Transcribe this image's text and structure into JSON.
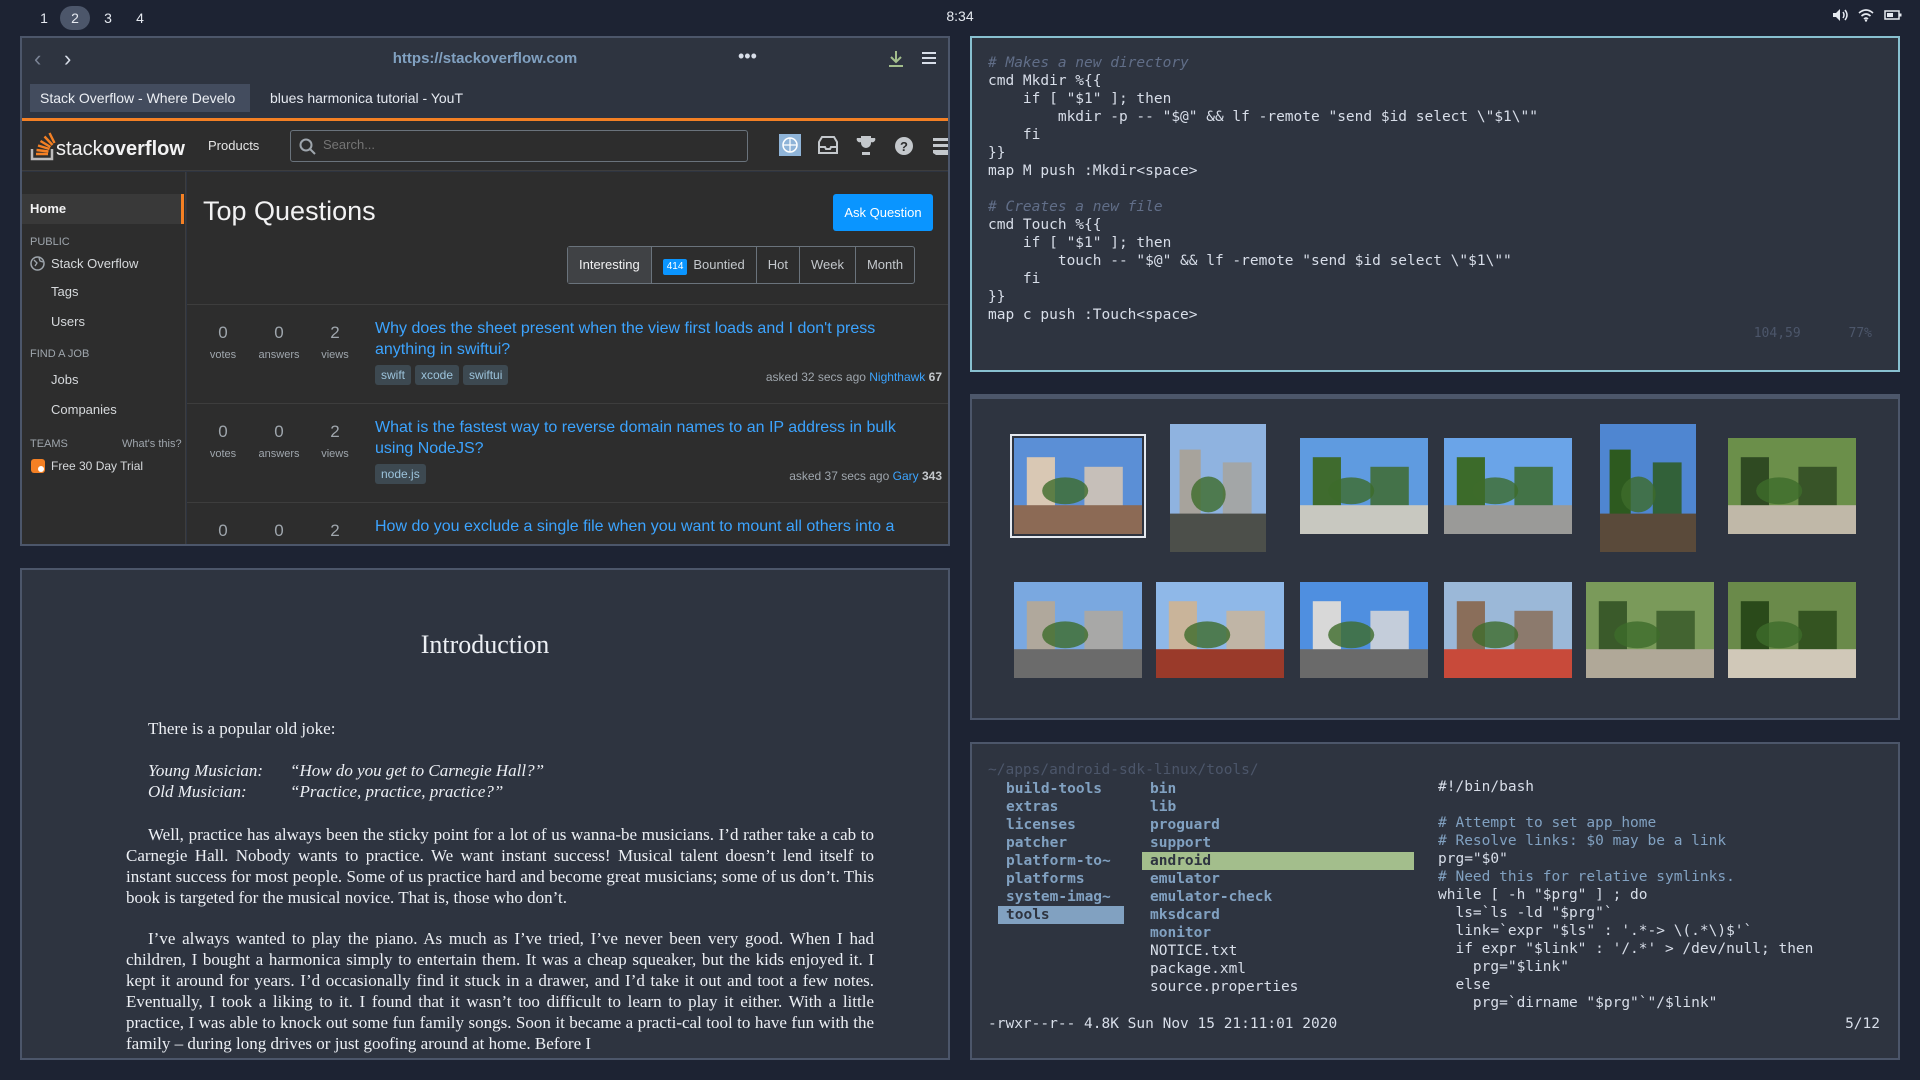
{
  "topbar": {
    "workspaces": [
      "1",
      "2",
      "3",
      "4"
    ],
    "active_workspace": "2",
    "clock": "8:34"
  },
  "browser": {
    "url": "https://stackoverflow.com",
    "tabs": [
      "Stack Overflow - Where Develo",
      "blues harmonica tutorial - YouT"
    ],
    "so": {
      "logo_text_light": "stack",
      "logo_text_bold": "overflow",
      "products": "Products",
      "search_placeholder": "Search...",
      "sidebar": {
        "home": "Home",
        "public": "PUBLIC",
        "stack_overflow": "Stack Overflow",
        "tags": "Tags",
        "users": "Users",
        "find_a_job": "FIND A JOB",
        "jobs": "Jobs",
        "companies": "Companies",
        "teams": "TEAMS",
        "whats_this": "What's this?",
        "free_trial": "Free 30 Day Trial"
      },
      "title": "Top Questions",
      "ask_button": "Ask Question",
      "filters": {
        "interesting": "Interesting",
        "bountied_count": "414",
        "bountied": "Bountied",
        "hot": "Hot",
        "week": "Week",
        "month": "Month"
      },
      "questions": [
        {
          "votes": "0",
          "votes_label": "votes",
          "answers": "0",
          "answers_label": "answers",
          "views": "2",
          "views_label": "views",
          "title": "Why does the sheet present when the view first loads and I don't press anything in swiftui?",
          "tags": [
            "swift",
            "xcode",
            "swiftui"
          ],
          "asked": "asked 32 secs ago",
          "user": "Nighthawk",
          "rep": "67"
        },
        {
          "votes": "0",
          "votes_label": "votes",
          "answers": "0",
          "answers_label": "answers",
          "views": "2",
          "views_label": "views",
          "title": "What is the fastest way to reverse domain names to an IP address in bulk using NodeJS?",
          "tags": [
            "node.js"
          ],
          "asked": "asked 37 secs ago",
          "user": "Gary",
          "rep": "343"
        },
        {
          "votes": "0",
          "answers": "0",
          "views": "2",
          "title": "How do you exclude a single file when you want to mount all others into a"
        }
      ]
    }
  },
  "pdf": {
    "title": "Introduction",
    "p1": "There is a popular old joke:",
    "dialog": [
      {
        "speaker": "Young Musician:",
        "line": "“How do you get to Carnegie Hall?”"
      },
      {
        "speaker": "Old Musician:",
        "line": "“Practice, practice, practice?”"
      }
    ],
    "p2": "Well, practice has always been the sticky point for a lot of us wanna-be musicians. I’d rather take a cab to Carnegie Hall. Nobody wants to practice. We want instant success! Musical talent doesn’t lend itself to instant success for most people. Some of us practice hard and become great musicians; some of us don’t. This book is targeted for the musical novice. That is, those who don’t.",
    "p3": "I’ve always wanted to play the piano. As much as I’ve tried, I’ve never been very good. When I had children, I bought a harmonica simply to entertain them. It was a cheap squeaker, but the kids enjoyed it. I kept it around for years. I’d occasionally find it stuck in a drawer, and I’d take it out and toot a few notes. Eventually, I took a liking to it. I found that it wasn’t too difficult to learn to play it either. With a little practice, I was able to knock out some fun family songs. Soon it became a practi-cal tool to have fun with the family – during long drives or just goofing around at home. Before I"
  },
  "editor": {
    "lines": [
      "# Makes a new directory",
      "cmd Mkdir %{{",
      "    if [ \"$1\" ]; then",
      "        mkdir -p -- \"$@\" && lf -remote \"send $id select \\\"$1\\\"\"",
      "    fi",
      "}}",
      "map M push :Mkdir<space>",
      "",
      "# Creates a new file",
      "cmd Touch %{{",
      "    if [ \"$1\" ]; then",
      "        touch -- \"$@\" && lf -remote \"send $id select \\\"$1\\\"\"",
      "    fi",
      "}}",
      "map c push :Touch<space>"
    ],
    "cursor_pos": "104,59",
    "scroll_pct": "77%"
  },
  "gallery": {
    "selected_index": 0,
    "thumbnail_count": 12
  },
  "fm": {
    "path": "~/apps/android-sdk-linux/tools/",
    "parent": [
      "build-tools",
      "extras",
      "licenses",
      "patcher",
      "platform-to~",
      "platforms",
      "system-imag~",
      "tools"
    ],
    "parent_selected": "tools",
    "current_dirs": [
      "bin",
      "lib",
      "proguard",
      "support",
      "android",
      "emulator",
      "emulator-check",
      "mksdcard",
      "monitor"
    ],
    "current_files": [
      "NOTICE.txt",
      "package.xml",
      "source.properties"
    ],
    "current_selected": "android",
    "preview": [
      "#!/bin/bash",
      "",
      "# Attempt to set app_home",
      "# Resolve links: $0 may be a link",
      "prg=\"$0\"",
      "# Need this for relative symlinks.",
      "while [ -h \"$prg\" ] ; do",
      "  ls=`ls -ld \"$prg\"`",
      "  link=`expr \"$ls\" : '.*-> \\(.*\\)$'`",
      "  if expr \"$link\" : '/.*' > /dev/null; then",
      "    prg=\"$link\"",
      "  else",
      "    prg=`dirname \"$prg\"`\"/$link\""
    ],
    "status": "-rwxr--r-- 4.8K Sun Nov 15 21:11:01 2020",
    "count": "5/12"
  }
}
